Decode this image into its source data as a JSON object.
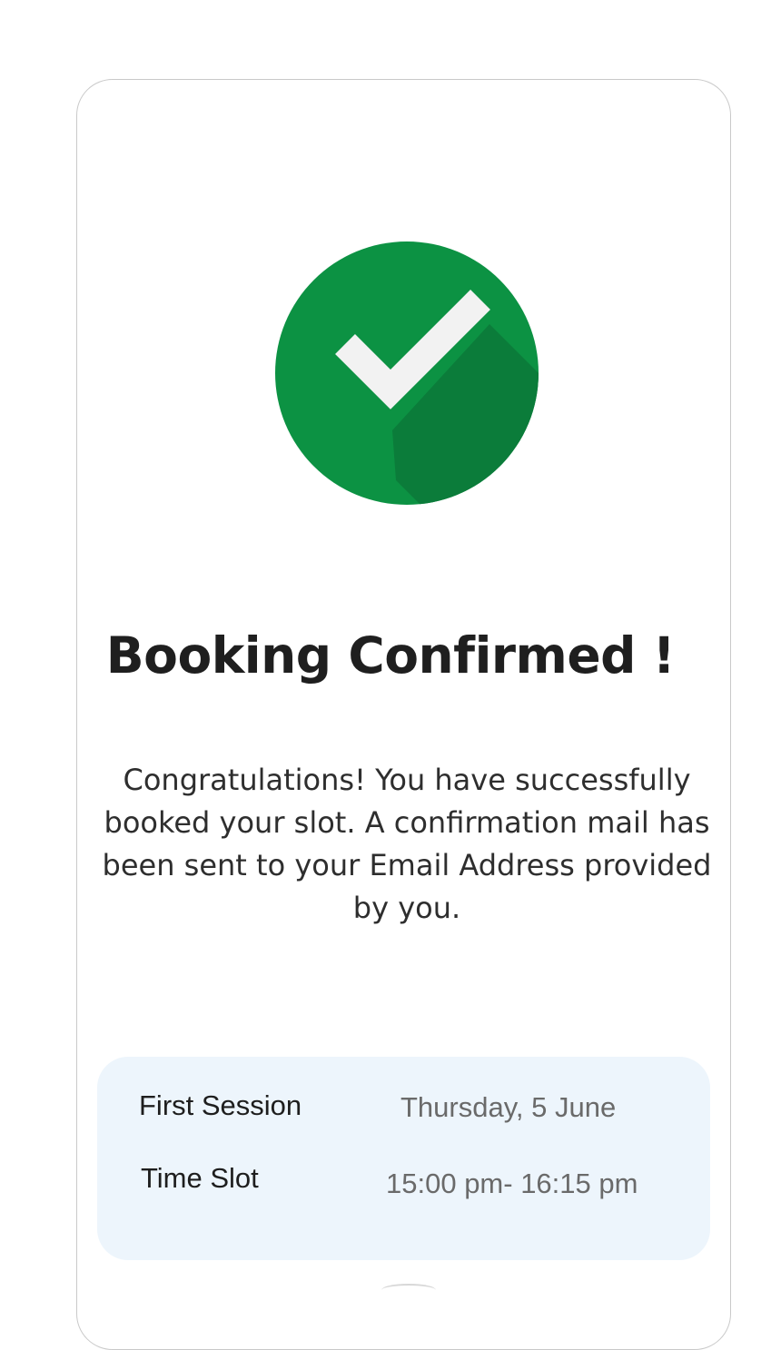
{
  "confirmation": {
    "icon": "check-circle-icon",
    "title": "Booking Confirmed !",
    "message": "Congratulations! You have successfully booked your slot. A confirmation mail has been sent to your Email Address provided by you."
  },
  "details": {
    "first_session": {
      "label": "First Session",
      "value": "Thursday, 5 June"
    },
    "time_slot": {
      "label": "Time Slot",
      "value": "15:00 pm- 16:15 pm"
    }
  },
  "colors": {
    "success_green": "#0c9243",
    "success_green_shadow": "#0b7c3a",
    "check_white": "#f2f2f2",
    "details_bg": "#edf5fc",
    "title_text": "#1f1f1f",
    "value_text": "#6a6a6a"
  }
}
